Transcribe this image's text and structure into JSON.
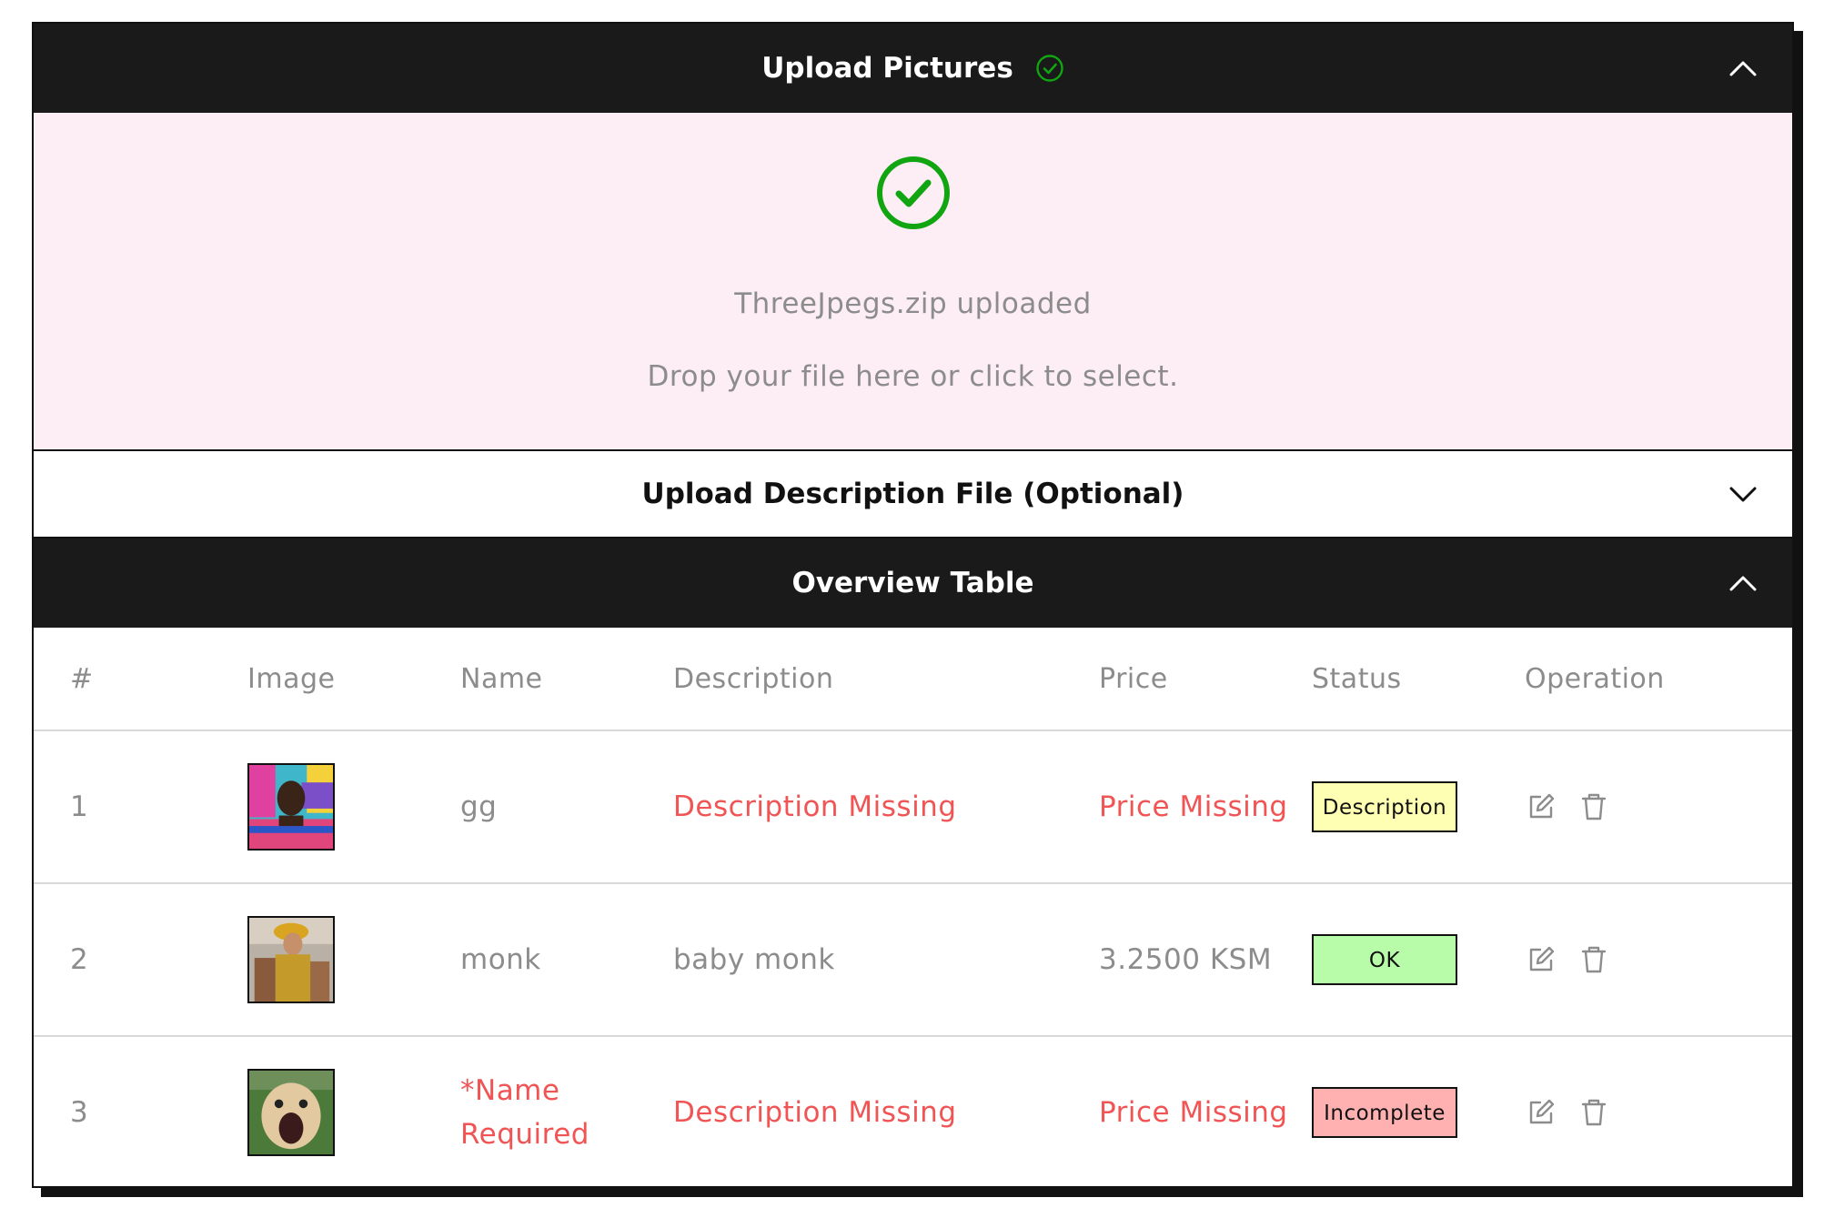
{
  "upload_pictures": {
    "title": "Upload Pictures",
    "uploaded_text": "ThreeJpegs.zip uploaded",
    "drop_hint": "Drop your file here or click to select."
  },
  "upload_description": {
    "title": "Upload Description File (Optional)"
  },
  "overview": {
    "title": "Overview Table",
    "columns": [
      "#",
      "Image",
      "Name",
      "Description",
      "Price",
      "Status",
      "Operation"
    ],
    "rows": [
      {
        "index": "1",
        "name": "gg",
        "description": "Description Missing",
        "price": "Price Missing",
        "status": "Description"
      },
      {
        "index": "2",
        "name": "monk",
        "description": "baby monk",
        "price": "3.2500 KSM",
        "status": "OK"
      },
      {
        "index": "3",
        "name": "*Name Required",
        "description": "Description Missing",
        "price": "Price Missing",
        "status": "Incomplete"
      }
    ]
  },
  "colors": {
    "header_dark": "#1a1a1a",
    "dropzone_bg": "#fdedf4",
    "success_green": "#12a512",
    "error_red": "#f05454",
    "status_description": "#ffffb3",
    "status_ok": "#b8fcaa",
    "status_incomplete": "#ffb0b0"
  },
  "icons": [
    "check-circle-icon",
    "chevron-up-icon",
    "chevron-down-icon",
    "edit-icon",
    "trash-icon"
  ]
}
